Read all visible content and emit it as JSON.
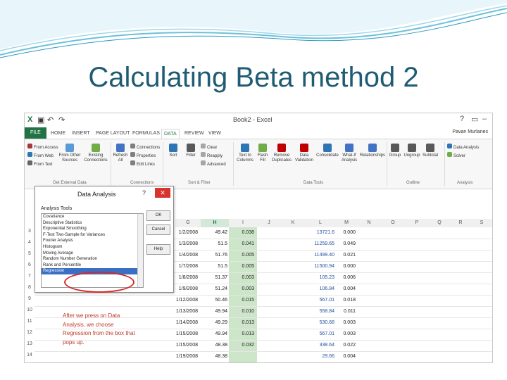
{
  "slide": {
    "title": "Calculating Beta method 2"
  },
  "excel": {
    "doc_title": "Book2 - Excel",
    "window_controls": [
      "?",
      "▭",
      "–"
    ],
    "user": "Pavan Murlanes",
    "tabs": [
      {
        "label": "FILE",
        "kind": "file"
      },
      {
        "label": "HOME"
      },
      {
        "label": "INSERT"
      },
      {
        "label": "PAGE LAYOUT"
      },
      {
        "label": "FORMULAS"
      },
      {
        "label": "DATA",
        "kind": "active"
      },
      {
        "label": "REVIEW"
      },
      {
        "label": "VIEW"
      }
    ],
    "ribbon": {
      "buttons": [
        {
          "label": "From Access",
          "icon": "access-icon",
          "color": "#a4373a"
        },
        {
          "label": "From Web",
          "icon": "web-icon",
          "color": "#2e75b6"
        },
        {
          "label": "From Text",
          "icon": "text-icon",
          "color": "#666666"
        },
        {
          "label": "From Other Sources",
          "icon": "other-sources-icon",
          "color": "#5b9bd5"
        },
        {
          "label": "Existing Connections",
          "icon": "connections-icon",
          "color": "#70ad47"
        },
        {
          "label": "Refresh All",
          "icon": "refresh-icon",
          "color": "#4472c4"
        },
        {
          "label": "Connections",
          "icon": "connections-small-icon",
          "color": "#7f7f7f"
        },
        {
          "label": "Properties",
          "icon": "properties-icon",
          "color": "#7f7f7f"
        },
        {
          "label": "Edit Links",
          "icon": "edit-links-icon",
          "color": "#7f7f7f"
        },
        {
          "label": "Sort",
          "icon": "sort-icon",
          "color": "#2e75b6"
        },
        {
          "label": "Filter",
          "icon": "filter-icon",
          "color": "#595959"
        },
        {
          "label": "Clear",
          "icon": "clear-icon",
          "color": "#a6a6a6"
        },
        {
          "label": "Reapply",
          "icon": "reapply-icon",
          "color": "#a6a6a6"
        },
        {
          "label": "Advanced",
          "icon": "advanced-icon",
          "color": "#a6a6a6"
        },
        {
          "label": "Text to Columns",
          "icon": "text-to-columns-icon",
          "color": "#2e75b6"
        },
        {
          "label": "Flash Fill",
          "icon": "flash-fill-icon",
          "color": "#70ad47"
        },
        {
          "label": "Remove Duplicates",
          "icon": "remove-duplicates-icon",
          "color": "#c00000"
        },
        {
          "label": "Data Validation",
          "icon": "data-validation-icon",
          "color": "#c00000"
        },
        {
          "label": "Consolidate",
          "icon": "consolidate-icon",
          "color": "#2e75b6"
        },
        {
          "label": "What-If Analysis",
          "icon": "what-if-icon",
          "color": "#4472c4"
        },
        {
          "label": "Relationships",
          "icon": "relationships-icon",
          "color": "#4472c4"
        },
        {
          "label": "Group",
          "icon": "group-icon",
          "color": "#595959"
        },
        {
          "label": "Ungroup",
          "icon": "ungroup-icon",
          "color": "#595959"
        },
        {
          "label": "Subtotal",
          "icon": "subtotal-icon",
          "color": "#595959"
        },
        {
          "label": "Data Analysis",
          "icon": "data-analysis-icon",
          "color": "#2e75b6"
        },
        {
          "label": "Solver",
          "icon": "solver-icon",
          "color": "#70ad47"
        }
      ],
      "groups": [
        "Get External Data",
        "Connections",
        "Sort & Filter",
        "Data Tools",
        "Outline",
        "Analysis"
      ]
    },
    "columns": [
      "G",
      "H",
      "I",
      "J",
      "K",
      "L",
      "M",
      "N",
      "O",
      "P",
      "Q",
      "R",
      "S"
    ],
    "rows": [
      {
        "n": "3",
        "date": "1/2/2008",
        "price": "49.42",
        "ret": "0.038",
        "mkt": "13721.6",
        "mret": "0.000"
      },
      {
        "n": "4",
        "date": "1/3/2008",
        "price": "51.5",
        "ret": "0.041",
        "mkt": "11259.65",
        "mret": "0.049"
      },
      {
        "n": "5",
        "date": "1/4/2008",
        "price": "51.76",
        "ret": "0.005",
        "mkt": "11499.40",
        "mret": "0.021"
      },
      {
        "n": "6",
        "date": "1/7/2008",
        "price": "51.5",
        "ret": "0.005",
        "mkt": "11500.94",
        "mret": "0.000"
      },
      {
        "n": "7",
        "date": "1/8/2008",
        "price": "51.37",
        "ret": "0.003",
        "mkt": "105.23",
        "mret": "0.006"
      },
      {
        "n": "8",
        "date": "1/9/2008",
        "price": "51.24",
        "ret": "0.003",
        "mkt": "106.84",
        "mret": "0.004"
      },
      {
        "n": "9",
        "date": "1/12/2008",
        "price": "50.46",
        "ret": "0.015",
        "mkt": "567.01",
        "mret": "0.018"
      },
      {
        "n": "10",
        "date": "1/13/2008",
        "price": "49.94",
        "ret": "0.010",
        "mkt": "558.84",
        "mret": "0.011"
      },
      {
        "n": "11",
        "date": "1/14/2008",
        "price": "49.29",
        "ret": "0.013",
        "mkt": "530.68",
        "mret": "0.003"
      },
      {
        "n": "12",
        "date": "1/15/2008",
        "price": "49.94",
        "ret": "0.013",
        "mkt": "567.01",
        "mret": "0.003"
      },
      {
        "n": "13",
        "date": "1/15/2008",
        "price": "48.38",
        "ret": "0.032",
        "mkt": "338.64",
        "mret": "0.022"
      },
      {
        "n": "14",
        "date": "1/19/2008",
        "price": "48.38",
        "ret": "",
        "mkt": "29.66",
        "mret": "0.004"
      }
    ],
    "note": "After we press on Data Analysis, we choose Regression from the box that pops up."
  },
  "dialog": {
    "title": "Data Analysis",
    "help_mark": "?",
    "close": "✕",
    "label": "Analysis Tools",
    "items": [
      "Covariance",
      "Descriptive Statistics",
      "Exponential Smoothing",
      "F-Test Two-Sample for Variances",
      "Fourier Analysis",
      "Histogram",
      "Moving Average",
      "Random Number Generation",
      "Rank and Percentile",
      "Regression"
    ],
    "selected_index": 9,
    "ok": "OK",
    "cancel": "Cancel",
    "help": "Help"
  }
}
